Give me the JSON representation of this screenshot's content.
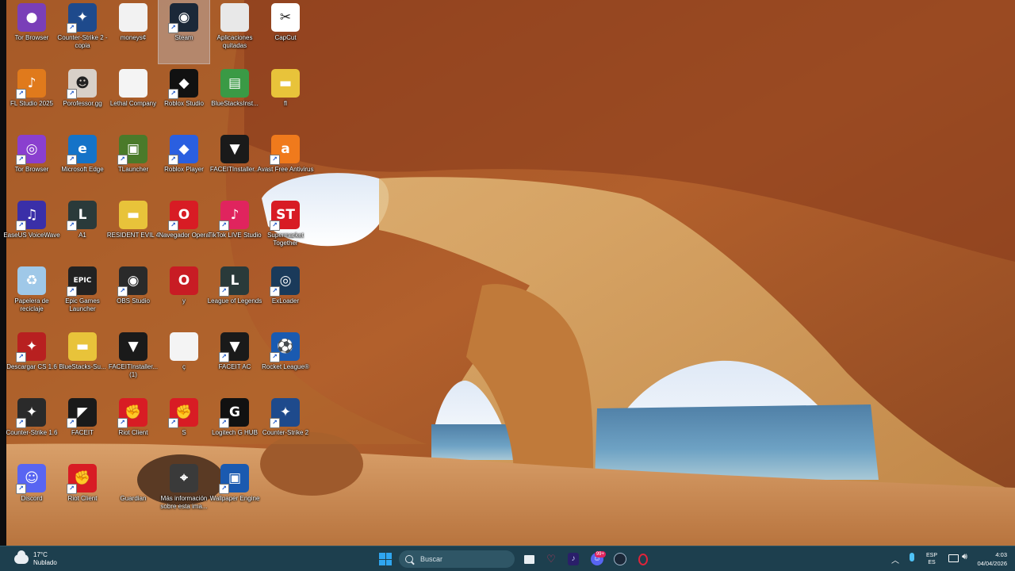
{
  "desktop_icons": [
    {
      "label": "Tor Browser",
      "color": "#7a3fb8",
      "glyph": "●",
      "shortcut": false
    },
    {
      "label": "Counter-Strike 2 - copia",
      "color": "#1e4a8c",
      "glyph": "✦",
      "shortcut": true
    },
    {
      "label": "moneys¢",
      "color": "#f2f2f2",
      "glyph": "",
      "shortcut": false
    },
    {
      "label": "Steam",
      "color": "#1b2838",
      "glyph": "◉",
      "shortcut": true,
      "selected": true
    },
    {
      "label": "Aplicaciones quitadas",
      "color": "#e8e8e8",
      "glyph": "",
      "shortcut": false
    },
    {
      "label": "CapCut",
      "color": "#ffffff",
      "glyph": "✂",
      "shortcut": false
    },
    {
      "label": "FL Studio 2025",
      "color": "#e07a1c",
      "glyph": "♪",
      "shortcut": true
    },
    {
      "label": "Porofessor.gg",
      "color": "#d8d0c8",
      "glyph": "☻",
      "shortcut": true
    },
    {
      "label": "Lethal Company",
      "color": "#f4f4f4",
      "glyph": "",
      "shortcut": false
    },
    {
      "label": "Roblox Studio",
      "color": "#111111",
      "glyph": "◆",
      "shortcut": true
    },
    {
      "label": "BlueStacksInst...",
      "color": "#3a9a45",
      "glyph": "▤",
      "shortcut": false
    },
    {
      "label": "fl",
      "color": "#e8c33a",
      "glyph": "▬",
      "shortcut": false
    },
    {
      "label": "Tor Browser",
      "color": "#8a3fcf",
      "glyph": "◎",
      "shortcut": true
    },
    {
      "label": "Microsoft Edge",
      "color": "#1473c8",
      "glyph": "e",
      "shortcut": true
    },
    {
      "label": "TLauncher",
      "color": "#4a7a2a",
      "glyph": "▣",
      "shortcut": true
    },
    {
      "label": "Roblox Player",
      "color": "#2a5fe0",
      "glyph": "◆",
      "shortcut": true
    },
    {
      "label": "FACEITInstaller...",
      "color": "#1a1a1a",
      "glyph": "▼",
      "shortcut": false
    },
    {
      "label": "Avast Free Antivirus",
      "color": "#f07a1c",
      "glyph": "a",
      "shortcut": true
    },
    {
      "label": "EaseUS VoiceWave",
      "color": "#3a2fa8",
      "glyph": "♫",
      "shortcut": true
    },
    {
      "label": "A1",
      "color": "#2a3a3a",
      "glyph": "L",
      "shortcut": true
    },
    {
      "label": "RESIDENT EVIL 4",
      "color": "#e8c33a",
      "glyph": "▬",
      "shortcut": false
    },
    {
      "label": "Navegador Opera",
      "color": "#d81c24",
      "glyph": "O",
      "shortcut": true
    },
    {
      "label": "TikTok LIVE Studio",
      "color": "#e0245e",
      "glyph": "♪",
      "shortcut": true
    },
    {
      "label": "Supermarket Together",
      "color": "#d81c24",
      "glyph": "ST",
      "shortcut": true
    },
    {
      "label": "Papelera de reciclaje",
      "color": "#9fc8e8",
      "glyph": "♻",
      "shortcut": false
    },
    {
      "label": "Epic Games Launcher",
      "color": "#222222",
      "glyph": "EPIC",
      "shortcut": true
    },
    {
      "label": "OBS Studio",
      "color": "#2a2a2a",
      "glyph": "◉",
      "shortcut": true
    },
    {
      "label": "y",
      "color": "#c81c24",
      "glyph": "O",
      "shortcut": false
    },
    {
      "label": "League of Legends",
      "color": "#2a3a3a",
      "glyph": "L",
      "shortcut": true
    },
    {
      "label": "ExLoader",
      "color": "#1a3a5a",
      "glyph": "◎",
      "shortcut": true
    },
    {
      "label": "Descargar CS 1.6",
      "color": "#b82020",
      "glyph": "✦",
      "shortcut": true
    },
    {
      "label": "BlueStacks-Su...",
      "color": "#e8c33a",
      "glyph": "▬",
      "shortcut": false
    },
    {
      "label": "FACEITInstaller... (1)",
      "color": "#1a1a1a",
      "glyph": "▼",
      "shortcut": false
    },
    {
      "label": "ç",
      "color": "#f4f4f4",
      "glyph": "",
      "shortcut": false
    },
    {
      "label": "FACEIT AC",
      "color": "#1a1a1a",
      "glyph": "▼",
      "shortcut": true
    },
    {
      "label": "Rocket League®",
      "color": "#1a5ab0",
      "glyph": "⚽",
      "shortcut": true
    },
    {
      "label": "Counter-Strike 1.6",
      "color": "#2a2a2a",
      "glyph": "✦",
      "shortcut": true
    },
    {
      "label": "FACEIT",
      "color": "#1a1a1a",
      "glyph": "◤",
      "shortcut": true
    },
    {
      "label": "Riot Client",
      "color": "#d81c24",
      "glyph": "✊",
      "shortcut": true
    },
    {
      "label": "S",
      "color": "#d81c24",
      "glyph": "✊",
      "shortcut": true
    },
    {
      "label": "Logitech G HUB",
      "color": "#111111",
      "glyph": "G",
      "shortcut": true
    },
    {
      "label": "Counter-Strike 2",
      "color": "#1e4a8c",
      "glyph": "✦",
      "shortcut": true
    },
    {
      "label": "Discord",
      "color": "#5865f2",
      "glyph": "☺",
      "shortcut": true
    },
    {
      "label": "Riot Client",
      "color": "#d81c24",
      "glyph": "✊",
      "shortcut": true
    },
    {
      "label": "Guardian",
      "color": "transparent",
      "glyph": "",
      "shortcut": false
    },
    {
      "label": "Más información sobre esta ima...",
      "color": "#3a3a3a",
      "glyph": "⌖",
      "shortcut": false
    },
    {
      "label": "Wallpaper Engine",
      "color": "#1a5ab0",
      "glyph": "▣",
      "shortcut": true
    }
  ],
  "taskbar": {
    "weather_temp": "17°C",
    "weather_desc": "Nublado",
    "search_placeholder": "Buscar",
    "pinned_badge": "99+",
    "tray_lang_1": "ESP",
    "tray_lang_2": "ES",
    "clock_time": "4:03",
    "clock_date": "04/04/2026"
  },
  "colors": {
    "taskbar_bg": "#1d3f4e",
    "accent": "#2fa6f0"
  }
}
